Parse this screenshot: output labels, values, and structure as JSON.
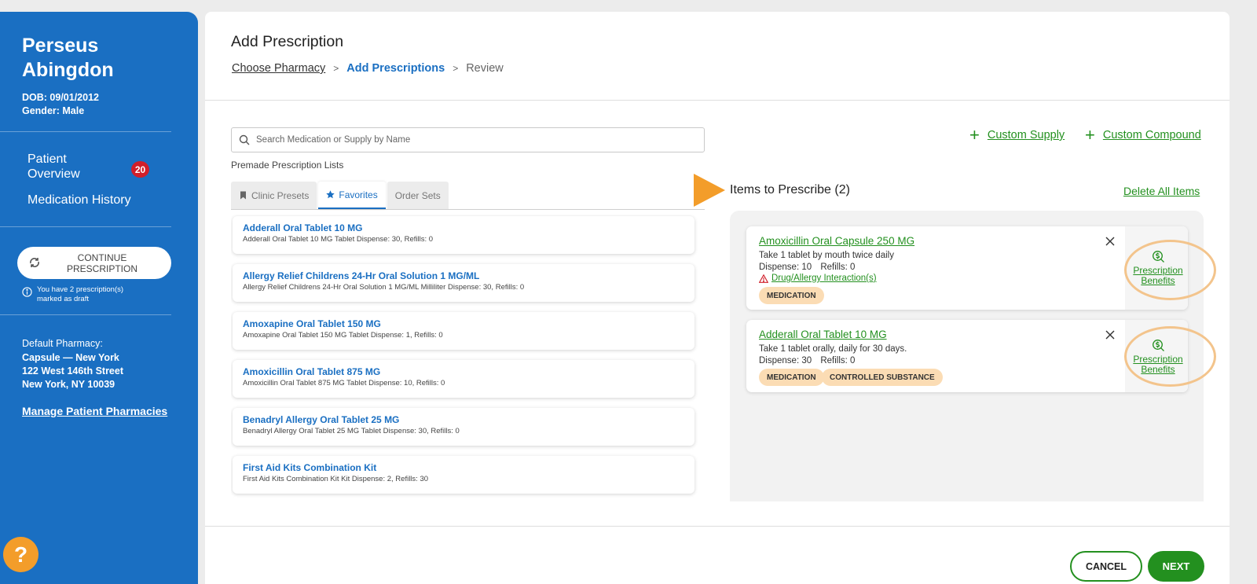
{
  "patient": {
    "name": "Perseus Abingdon",
    "dob": "DOB: 09/01/2012",
    "gender": "Gender: Male"
  },
  "sidebar": {
    "nav": [
      {
        "label": "Patient Overview",
        "badge": "20"
      },
      {
        "label": "Medication History"
      }
    ],
    "continue_label": "CONTINUE PRESCRIPTION",
    "draft_note": "You have 2 prescription(s) marked as draft",
    "pharmacy_label": "Default Pharmacy:",
    "pharmacy_lines": [
      "Capsule — New York",
      "122 West 146th Street",
      "New York, NY 10039"
    ],
    "manage_link": "Manage Patient Pharmacies",
    "help": "?"
  },
  "header": {
    "title": "Add Prescription",
    "breadcrumb": [
      "Choose Pharmacy",
      "Add Prescriptions",
      "Review"
    ],
    "sep": ">"
  },
  "search": {
    "placeholder": "Search Medication or Supply by Name",
    "value": ""
  },
  "premade_label": "Premade Prescription Lists",
  "tabs": [
    {
      "label": "Clinic Presets",
      "icon": "bookmark-icon",
      "active": false
    },
    {
      "label": "Favorites",
      "icon": "star-icon",
      "active": true
    },
    {
      "label": "Order Sets",
      "active": false
    }
  ],
  "medications": [
    {
      "name": "Adderall Oral Tablet 10 MG",
      "detail": "Adderall Oral Tablet 10 MG Tablet Dispense: 30, Refills: 0"
    },
    {
      "name": "Allergy Relief Childrens 24-Hr Oral Solution 1 MG/ML",
      "detail": "Allergy Relief Childrens 24-Hr Oral Solution 1 MG/ML Milliliter Dispense: 30, Refills: 0"
    },
    {
      "name": "Amoxapine Oral Tablet 150 MG",
      "detail": "Amoxapine Oral Tablet 150 MG Tablet Dispense: 1, Refills: 0"
    },
    {
      "name": "Amoxicillin Oral Tablet 875 MG",
      "detail": "Amoxicillin Oral Tablet 875 MG Tablet Dispense: 10, Refills: 0"
    },
    {
      "name": "Benadryl Allergy Oral Tablet 25 MG",
      "detail": "Benadryl Allergy Oral Tablet 25 MG Tablet Dispense: 30, Refills: 0"
    },
    {
      "name": "First Aid Kits Combination Kit",
      "detail": "First Aid Kits Combination Kit Kit Dispense: 2, Refills: 30"
    }
  ],
  "actions": {
    "custom_supply": "Custom Supply",
    "custom_compound": "Custom Compound",
    "delete_all": "Delete All Items"
  },
  "items_title": "Items to Prescribe (2)",
  "prescriptions": [
    {
      "name": "Amoxicillin Oral Capsule 250 MG",
      "sig": "Take 1 tablet by mouth twice daily",
      "dispense": "Dispense: 10",
      "refills": "Refills: 0",
      "warning": "Drug/Allergy Interaction(s)",
      "tags": [
        "MEDICATION"
      ],
      "benefits": "Prescription Benefits"
    },
    {
      "name": "Adderall Oral Tablet 10 MG",
      "sig": "Take 1 tablet orally, daily for 30 days.",
      "dispense": "Dispense: 30",
      "refills": "Refills: 0",
      "tags": [
        "MEDICATION",
        "CONTROLLED SUBSTANCE"
      ],
      "benefits": "Prescription Benefits"
    }
  ],
  "footer": {
    "cancel": "CANCEL",
    "next": "NEXT"
  },
  "colors": {
    "sidebar": "#1a6fc2",
    "accent_green": "#23901f",
    "accent_orange": "#f39d2a",
    "badge_red": "#d11f2a",
    "tag_bg": "#fbdcb4"
  }
}
